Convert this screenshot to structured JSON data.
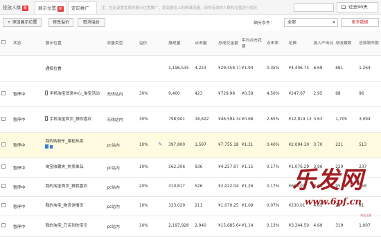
{
  "tabs": [
    {
      "label": "投放人群",
      "badge": "新"
    },
    {
      "label": "展示位置",
      "badge": "新"
    },
    {
      "label": "定向推广",
      "badge": ""
    }
  ],
  "hint": "注：在此设置优质的展示位置推广，提高展位上的精准流量，请将有效的人群和位置进行优化",
  "period": "过去90天",
  "toolbar": {
    "add_label": "+ 添加展示位置",
    "edit_bid_label": "修改溢价",
    "cancel_bid_label": "取消溢价",
    "filter_prefix": "细分条件：",
    "filter_value": "全部",
    "more_label": "更多数据"
  },
  "columns": [
    "状态",
    "展示位置",
    "流量类型",
    "溢价",
    "展现量",
    "点击量",
    "总成交金额",
    "平均点击花费",
    "点击率",
    "花费",
    "投入产出比",
    "总收藏数",
    "总购物车数"
  ],
  "summary": {
    "position": "通投位置",
    "views": "1,196,535",
    "clicks": "4,223",
    "amount": "¥29,458.77",
    "cpc": "¥1.94",
    "ctr": "0.35%",
    "spend": "¥4,406.74",
    "roi": "6.69",
    "fav": "681",
    "cart": "1,264"
  },
  "rows": [
    {
      "status": "暂停中",
      "position": "手机淘宝消息中心_淘宝活动",
      "mobile": true,
      "traffic": "无线站内",
      "premium": "30%",
      "views": "9,400",
      "clicks": "423",
      "amount": "¥729.98",
      "cpc": "¥0.58",
      "ctr": "4.50%",
      "spend": "¥247.07",
      "roi": "2.95",
      "fav": "68",
      "cart": "96",
      "hl": false
    },
    {
      "status": "暂停中",
      "position": "手机淘宝首页_猜你喜欢",
      "mobile": true,
      "traffic": "无线站内",
      "premium": "30%",
      "views": "798,901",
      "clicks": "18,822",
      "amount": "¥46,594.34",
      "cpc": "¥0.68",
      "ctr": "2.65%",
      "spend": "¥12,819.13",
      "roi": "3.63",
      "fav": "1,709",
      "cart": "3,094",
      "hl": false
    },
    {
      "status": "暂停中",
      "position": "我的购物车_掌柜热卖",
      "mobile": false,
      "traffic": "pc站内",
      "premium": "10%",
      "views": "397,800",
      "clicks": "1,597",
      "amount": "¥7,755.18",
      "cpc": "¥1.31",
      "ctr": "0.40%",
      "spend": "¥2,094.30",
      "roi": "3.70",
      "fav": "221",
      "cart": "513",
      "hl": true
    },
    {
      "status": "暂停中",
      "position": "淘宝收藏夹_热卖单品",
      "mobile": false,
      "traffic": "pc站内",
      "premium": "10%",
      "views": "562,306",
      "clicks": "936",
      "amount": "¥4,257.97",
      "cpc": "¥1.15",
      "ctr": "0.17%",
      "spend": "¥1,076.29",
      "roi": "3.96",
      "fav": "229",
      "cart": "237",
      "hl": false
    },
    {
      "status": "暂停中",
      "position": "我的淘宝首页_猜我喜欢",
      "mobile": false,
      "traffic": "pc站内",
      "premium": "20%",
      "views": "310,817",
      "clicks": "526",
      "amount": "¥2,022.04",
      "cpc": "¥1.26",
      "ctr": "0.17%",
      "spend": "¥664.09",
      "roi": "3.04",
      "fav": "95",
      "cart": "158",
      "hl": false
    },
    {
      "status": "暂停中",
      "position": "我的淘宝_物流详情页",
      "mobile": false,
      "traffic": "pc站内",
      "premium": "10%",
      "views": "323,029",
      "clicks": "211",
      "amount": "¥1,070.25",
      "cpc": "¥1.09",
      "ctr": "0.07%",
      "spend": "¥230.01",
      "roi": "4.65",
      "fav": "29",
      "cart": "81",
      "hl": false
    },
    {
      "status": "暂停中",
      "position": "我的淘宝_已买到的宝贝",
      "mobile": false,
      "traffic": "pc站内",
      "premium": "10%",
      "views": "2,197,928",
      "clicks": "2,940",
      "amount": "¥15,685.64",
      "cpc": "¥1.14",
      "ctr": "0.13%",
      "spend": "¥3,344.50",
      "roi": "4.69",
      "fav": "319",
      "cart": "1,007",
      "hl": false
    }
  ],
  "watermark": {
    "brand": "乐发网",
    "url": "www.6pf.cn",
    "sub": "淘宝运营"
  }
}
